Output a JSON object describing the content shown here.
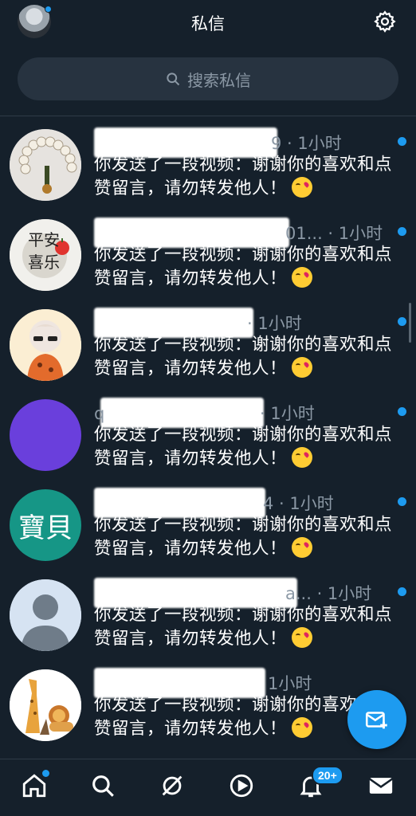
{
  "header": {
    "title": "私信",
    "settings_icon": "gear-icon"
  },
  "search": {
    "placeholder": "搜索私信",
    "icon": "search-icon"
  },
  "conversations": [
    {
      "time": "9 · 1小时",
      "message": "你发送了一段视频：谢谢你的喜欢和点赞留言，请勿转发他人！",
      "avatar_style": "beads"
    },
    {
      "time": "01... · 1小时",
      "message": "你发送了一段视频：谢谢你的喜欢和点赞留言，请勿转发他人！",
      "avatar_text": "平安喜乐"
    },
    {
      "time": "· 1小时",
      "message": "你发送了一段视频：谢谢你的喜欢和点赞留言，请勿转发他人！",
      "avatar_style": "cartoon-boy"
    },
    {
      "time": "q · 1小时",
      "message": "你发送了一段视频：谢谢你的喜欢和点赞留言，请勿转发他人！",
      "avatar_style": "purple"
    },
    {
      "time": "4 · 1小时",
      "message": "你发送了一段视频：谢谢你的喜欢和点赞留言，请勿转发他人！",
      "avatar_text": "寶貝"
    },
    {
      "time": "a... · 1小时",
      "message": "你发送了一段视频：谢谢你的喜欢和点赞留言，请勿转发他人！",
      "avatar_style": "default-person"
    },
    {
      "time": "1小时",
      "message": "你发送了一段视频：谢谢你的喜欢和点赞留言，请勿转发他人！",
      "avatar_style": "giraffe-lion"
    }
  ],
  "fab": {
    "icon": "new-message-icon"
  },
  "bottom_nav": {
    "items": [
      "home-icon",
      "search-icon",
      "spaces-icon",
      "video-icon",
      "notifications-icon",
      "messages-icon"
    ],
    "notifications_badge": "20+"
  },
  "colors": {
    "background": "#15202b",
    "accent": "#1d9bf0",
    "muted_text": "#8b98a5"
  }
}
